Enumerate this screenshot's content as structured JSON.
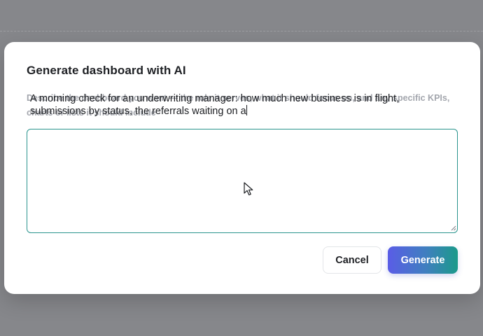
{
  "modal": {
    "title": "Generate dashboard with AI",
    "description": "Describe the dashboard you want — the role it serves, what it should focus on, and any specific KPIs, charts or lists it should include",
    "prompt_line_1": "A morning check for an underwriting manager: how much new business is in flight,",
    "prompt_line_2": "submissions by status, the referrals waiting on a"
  },
  "actions": {
    "cancel_label": "Cancel",
    "generate_label": "Generate"
  },
  "colors": {
    "overlay": "#86878b",
    "accent_border": "#2a948d",
    "generate_gradient_start": "#5a5de6",
    "generate_gradient_end": "#1b9a8a"
  },
  "icons": {
    "cursor": "mouse-pointer-icon",
    "resize": "resize-grip-icon"
  }
}
